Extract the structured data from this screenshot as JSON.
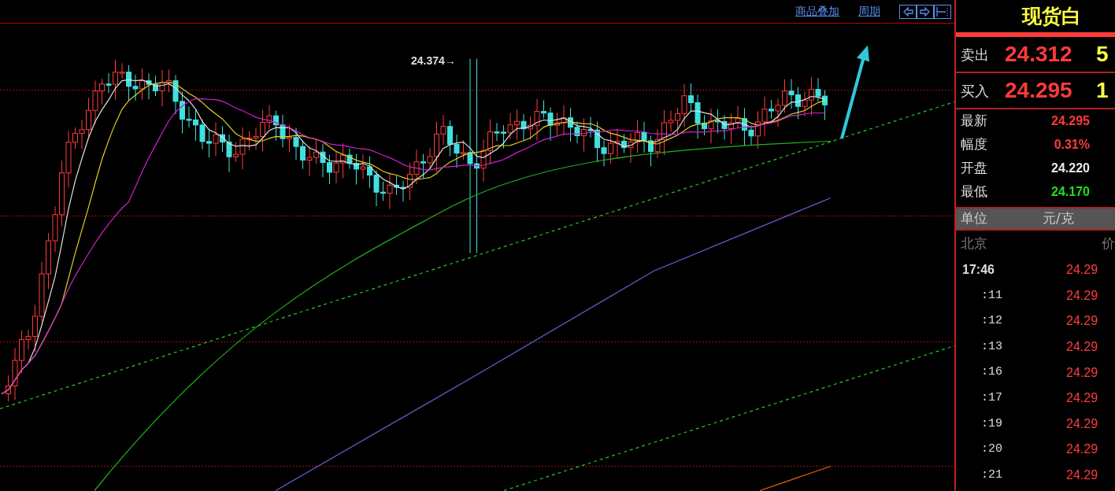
{
  "toolbar": {
    "links": [
      "商品叠加",
      "周期"
    ]
  },
  "chart": {
    "annotation": "24.374→"
  },
  "quote_panel": {
    "title": "现货白",
    "orders": [
      {
        "label": "卖出",
        "price": "24.312",
        "volume": "5"
      },
      {
        "label": "买入",
        "price": "24.295",
        "volume": "1"
      }
    ],
    "stats": [
      {
        "label": "最新",
        "value": "24.295",
        "color": "#ff3b3b"
      },
      {
        "label": "幅度",
        "value": "0.31%",
        "color": "#ff3b3b"
      },
      {
        "label": "开盘",
        "value": "24.220",
        "color": "#e8e8e8"
      },
      {
        "label": "最低",
        "value": "24.170",
        "color": "#22dd22"
      }
    ],
    "unit": {
      "label": "单位",
      "value": "元/克"
    },
    "ticks_header": {
      "time": "北京",
      "price": "价"
    },
    "ticks": [
      {
        "kind": "minute",
        "time": "17:46",
        "price": "24.29"
      },
      {
        "kind": "second",
        "time": ":11",
        "price": "24.29"
      },
      {
        "kind": "second",
        "time": ":12",
        "price": "24.29"
      },
      {
        "kind": "second",
        "time": ":13",
        "price": "24.29"
      },
      {
        "kind": "second",
        "time": ":16",
        "price": "24.29"
      },
      {
        "kind": "second",
        "time": ":17",
        "price": "24.29"
      },
      {
        "kind": "second",
        "time": ":19",
        "price": "24.29"
      },
      {
        "kind": "second",
        "time": ":20",
        "price": "24.29"
      },
      {
        "kind": "second",
        "time": ":21",
        "price": "24.29"
      }
    ]
  }
}
